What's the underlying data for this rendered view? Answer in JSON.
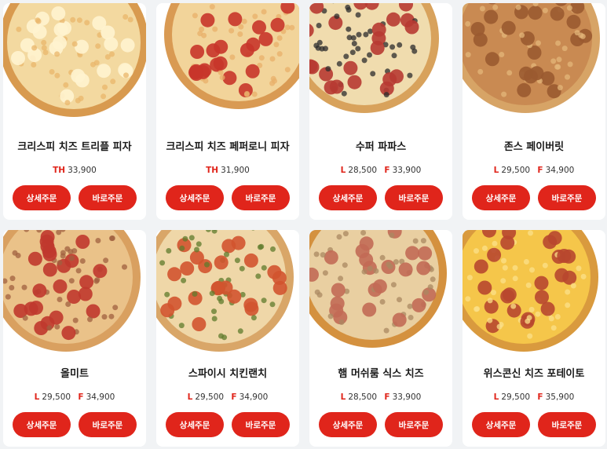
{
  "buttons": {
    "detail": "상세주문",
    "quick": "바로주문"
  },
  "pizzas": [
    {
      "name": "크리스피 치즈 트리플 피자",
      "prices": [
        {
          "size": "TH",
          "price": "33,900"
        }
      ],
      "style": {
        "crust": "#d89a4f",
        "base": "#f3d9a0",
        "spots": "#fff3cf",
        "spot2": "#e9b66b",
        "rim": true
      }
    },
    {
      "name": "크리스피 치즈 페퍼로니 피자",
      "prices": [
        {
          "size": "TH",
          "price": "31,900"
        }
      ],
      "style": {
        "crust": "#d99a53",
        "base": "#f2d49a",
        "spots": "#c8352a",
        "spot2": "#e8b06a",
        "rim": true
      }
    },
    {
      "name": "수퍼 파파스",
      "prices": [
        {
          "size": "L",
          "price": "28,500"
        },
        {
          "size": "F",
          "price": "33,900"
        }
      ],
      "style": {
        "crust": "#d8a25c",
        "base": "#f0dcae",
        "spots": "#b73a32",
        "spot2": "#2c2c2c",
        "rim": true
      }
    },
    {
      "name": "존스 페이버릿",
      "prices": [
        {
          "size": "L",
          "price": "29,500"
        },
        {
          "size": "F",
          "price": "34,900"
        }
      ],
      "style": {
        "crust": "#d7a466",
        "base": "#c98a52",
        "spots": "#9a5a30",
        "spot2": "#e3b57a",
        "rim": true
      }
    },
    {
      "name": "올미트",
      "prices": [
        {
          "size": "L",
          "price": "29,500"
        },
        {
          "size": "F",
          "price": "34,900"
        }
      ],
      "style": {
        "crust": "#d9a060",
        "base": "#eac289",
        "spots": "#c0382e",
        "spot2": "#a06040",
        "rim": true
      }
    },
    {
      "name": "스파이시 치킨랜치",
      "prices": [
        {
          "size": "L",
          "price": "29,500"
        },
        {
          "size": "F",
          "price": "34,900"
        }
      ],
      "style": {
        "crust": "#d9a668",
        "base": "#efd7a8",
        "spots": "#d2542f",
        "spot2": "#5f7b2c",
        "rim": true
      }
    },
    {
      "name": "햄 머쉬룸 식스 치즈",
      "prices": [
        {
          "size": "L",
          "price": "28,500"
        },
        {
          "size": "F",
          "price": "33,900"
        }
      ],
      "style": {
        "crust": "#d4913f",
        "base": "#e9cfa1",
        "spots": "#c26a55",
        "spot2": "#a98861",
        "rim": true
      }
    },
    {
      "name": "위스콘신 치즈 포테이토",
      "prices": [
        {
          "size": "L",
          "price": "29,500"
        },
        {
          "size": "F",
          "price": "35,900"
        }
      ],
      "style": {
        "crust": "#d99a3e",
        "base": "#f5c64a",
        "spots": "#b8472f",
        "spot2": "#fbe08a",
        "rim": true
      }
    }
  ]
}
